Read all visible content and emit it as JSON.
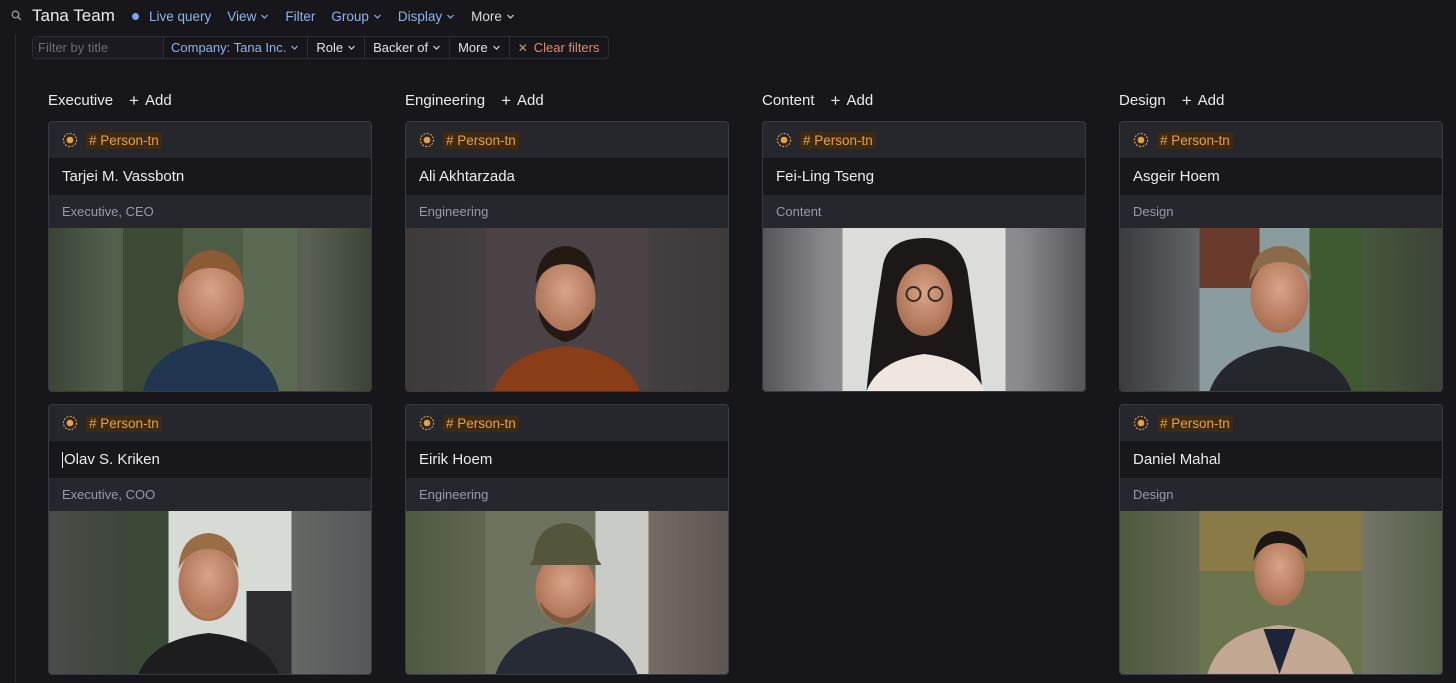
{
  "header": {
    "title": "Tana Team",
    "menu": [
      {
        "label": "Live query"
      },
      {
        "label": "View"
      },
      {
        "label": "Filter"
      },
      {
        "label": "Group"
      },
      {
        "label": "Display"
      },
      {
        "label": "More"
      }
    ]
  },
  "filters": {
    "placeholder": "Filter by title",
    "company": "Company: Tana Inc.",
    "role": "Role",
    "backer": "Backer of",
    "more": "More",
    "clear": "Clear filters"
  },
  "columns": [
    {
      "label": "Executive",
      "add": "Add"
    },
    {
      "label": "Engineering",
      "add": "Add"
    },
    {
      "label": "Content",
      "add": "Add"
    },
    {
      "label": "Design",
      "add": "Add"
    }
  ],
  "cards": {
    "tag": "# Person-tn",
    "tarjei": {
      "name": "Tarjei M. Vassbotn",
      "role": "Executive, CEO"
    },
    "olav": {
      "name": "Olav S. Kriken",
      "role": "Executive, COO"
    },
    "ali": {
      "name": "Ali Akhtarzada",
      "role": "Engineering"
    },
    "eirik": {
      "name": "Eirik Hoem",
      "role": "Engineering"
    },
    "feiling": {
      "name": "Fei-Ling Tseng",
      "role": "Content"
    },
    "asgeir": {
      "name": "Asgeir Hoem",
      "role": "Design"
    },
    "daniel": {
      "name": "Daniel Mahal",
      "role": "Design"
    }
  },
  "colors": {
    "accent": "#8fb4ea",
    "tag": "#e8a23a",
    "clear": "#e08a6e"
  }
}
